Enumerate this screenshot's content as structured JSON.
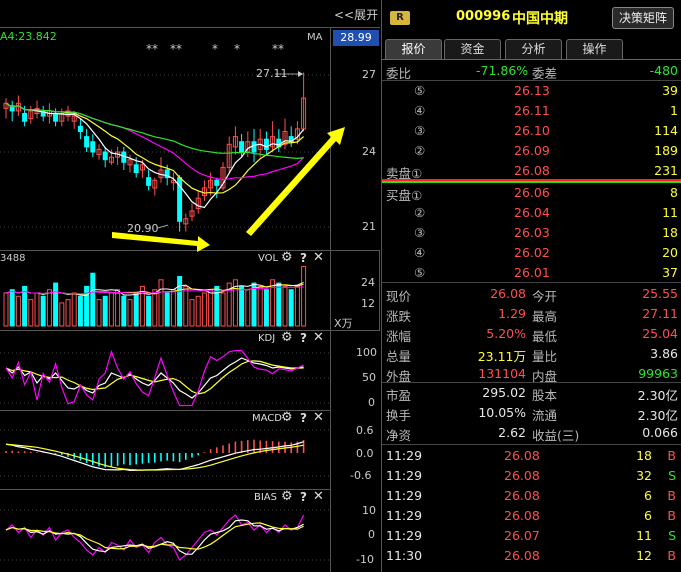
{
  "left_panel": {
    "expand_label": "<<展开",
    "ma_label": "A4:23.842",
    "ma_tag": "MA",
    "price_tag": "28.99",
    "star_marks": [
      "**",
      "**",
      "*",
      "*",
      "**"
    ],
    "price_axis": [
      "27",
      "24",
      "21"
    ],
    "high_label": "27.11",
    "low_label": "20.90",
    "vol": {
      "label": "VOL",
      "left_value": "3488",
      "axis": [
        "24",
        "12"
      ],
      "unit": "X万"
    },
    "kdj": {
      "label": "KDJ",
      "axis": [
        "100",
        "50",
        "0"
      ]
    },
    "macd": {
      "label": "MACD",
      "axis": [
        "0.6",
        "0.0",
        "-0.6"
      ]
    },
    "bias": {
      "label": "BIAS",
      "axis": [
        "10",
        "0",
        "-10"
      ]
    },
    "panel_icons": [
      "gear-icon",
      "help-icon",
      "close-icon"
    ]
  },
  "header": {
    "badge": "R",
    "code": "000996",
    "name": "中国中期",
    "button": "决策矩阵"
  },
  "tabs": [
    "报价",
    "资金",
    "分析",
    "操作"
  ],
  "weibi": {
    "label1": "委比",
    "value1": "-71.86%",
    "label2": "委差",
    "value2": "-480"
  },
  "sells": [
    {
      "label": "⑤",
      "price": "26.13",
      "vol": "39"
    },
    {
      "label": "④",
      "price": "26.11",
      "vol": "1"
    },
    {
      "label": "③",
      "price": "26.10",
      "vol": "114"
    },
    {
      "label": "②",
      "price": "26.09",
      "vol": "189"
    },
    {
      "label": "卖盘①",
      "price": "26.08",
      "vol": "231"
    }
  ],
  "buys": [
    {
      "label": "买盘①",
      "price": "26.06",
      "vol": "8"
    },
    {
      "label": "②",
      "price": "26.04",
      "vol": "11"
    },
    {
      "label": "③",
      "price": "26.03",
      "vol": "18"
    },
    {
      "label": "④",
      "price": "26.02",
      "vol": "20"
    },
    {
      "label": "⑤",
      "price": "26.01",
      "vol": "37"
    }
  ],
  "stats": [
    {
      "l1": "现价",
      "v1": "26.08",
      "c1": "red",
      "l2": "今开",
      "v2": "25.55",
      "c2": "red"
    },
    {
      "l1": "涨跌",
      "v1": "1.29",
      "c1": "red",
      "l2": "最高",
      "v2": "27.11",
      "c2": "red"
    },
    {
      "l1": "涨幅",
      "v1": "5.20%",
      "c1": "red",
      "l2": "最低",
      "v2": "25.04",
      "c2": "red"
    },
    {
      "l1": "总量",
      "v1": "23.11万",
      "c1": "yellow",
      "l2": "量比",
      "v2": "3.86",
      "c2": "white"
    },
    {
      "l1": "外盘",
      "v1": "131104",
      "c1": "red",
      "l2": "内盘",
      "v2": "99963",
      "c2": "green"
    }
  ],
  "stats2": [
    {
      "l1": "市盈",
      "v1": "295.02",
      "l2": "股本",
      "v2": "2.30亿"
    },
    {
      "l1": "换手",
      "v1": "10.05%",
      "l2": "流通",
      "v2": "2.30亿"
    },
    {
      "l1": "净资",
      "v1": "2.62",
      "l2": "收益(三)",
      "v2": "0.066"
    }
  ],
  "ticks": [
    {
      "time": "11:29",
      "price": "26.08",
      "vol": "18",
      "dir": "B"
    },
    {
      "time": "11:29",
      "price": "26.08",
      "vol": "32",
      "dir": "S"
    },
    {
      "time": "11:29",
      "price": "26.08",
      "vol": "6",
      "dir": "B"
    },
    {
      "time": "11:29",
      "price": "26.08",
      "vol": "6",
      "dir": "B"
    },
    {
      "time": "11:29",
      "price": "26.07",
      "vol": "11",
      "dir": "S"
    },
    {
      "time": "11:30",
      "price": "26.08",
      "vol": "12",
      "dir": "B"
    }
  ],
  "colors": {
    "up": "#ff4e4e",
    "down": "#2de32d",
    "yellow": "#ffff33",
    "cyan": "#00ffff",
    "magenta": "#ff00ff"
  }
}
